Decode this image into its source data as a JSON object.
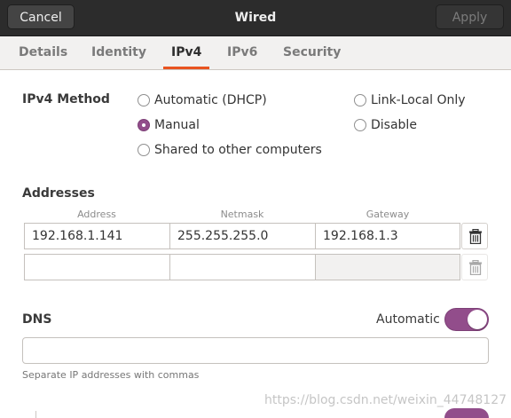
{
  "header": {
    "title": "Wired",
    "cancel_label": "Cancel",
    "apply_label": "Apply"
  },
  "tabs": [
    {
      "label": "Details",
      "active": false
    },
    {
      "label": "Identity",
      "active": false
    },
    {
      "label": "IPv4",
      "active": true
    },
    {
      "label": "IPv6",
      "active": false
    },
    {
      "label": "Security",
      "active": false
    }
  ],
  "ipv4_method": {
    "label": "IPv4 Method",
    "options": [
      {
        "label": "Automatic (DHCP)",
        "selected": false
      },
      {
        "label": "Manual",
        "selected": true
      },
      {
        "label": "Shared to other computers",
        "selected": false
      },
      {
        "label": "Link-Local Only",
        "selected": false
      },
      {
        "label": "Disable",
        "selected": false
      }
    ]
  },
  "addresses": {
    "label": "Addresses",
    "columns": [
      "Address",
      "Netmask",
      "Gateway"
    ],
    "rows": [
      {
        "address": "192.168.1.141",
        "netmask": "255.255.255.0",
        "gateway": "192.168.1.3"
      },
      {
        "address": "",
        "netmask": "",
        "gateway": ""
      }
    ]
  },
  "dns": {
    "label": "DNS",
    "automatic_label": "Automatic",
    "automatic_on": true,
    "value": "",
    "hint": "Separate IP addresses with commas"
  },
  "watermark": "https://blog.csdn.net/weixin_44748127",
  "colors": {
    "accent": "#e95420",
    "selected": "#924d8b",
    "header_bg": "#2c2c2c"
  }
}
